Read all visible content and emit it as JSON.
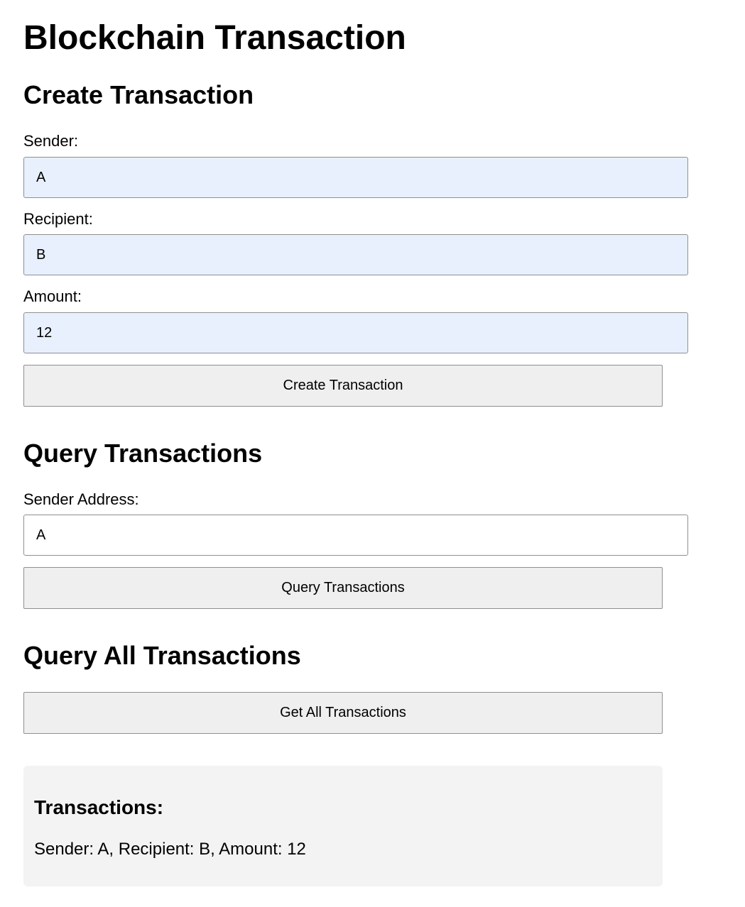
{
  "page_title": "Blockchain Transaction",
  "create_section": {
    "heading": "Create Transaction",
    "sender_label": "Sender:",
    "sender_value": "A",
    "recipient_label": "Recipient:",
    "recipient_value": "B",
    "amount_label": "Amount:",
    "amount_value": "12",
    "submit_label": "Create Transaction"
  },
  "query_section": {
    "heading": "Query Transactions",
    "address_label": "Sender Address:",
    "address_value": "A",
    "submit_label": "Query Transactions"
  },
  "query_all_section": {
    "heading": "Query All Transactions",
    "submit_label": "Get All Transactions"
  },
  "results": {
    "heading": "Transactions:",
    "items": [
      "Sender: A, Recipient: B, Amount: 12"
    ]
  },
  "colors": {
    "autofill_background": "#e8f0fe",
    "button_background": "#efefef",
    "result_background": "#f3f3f3"
  }
}
